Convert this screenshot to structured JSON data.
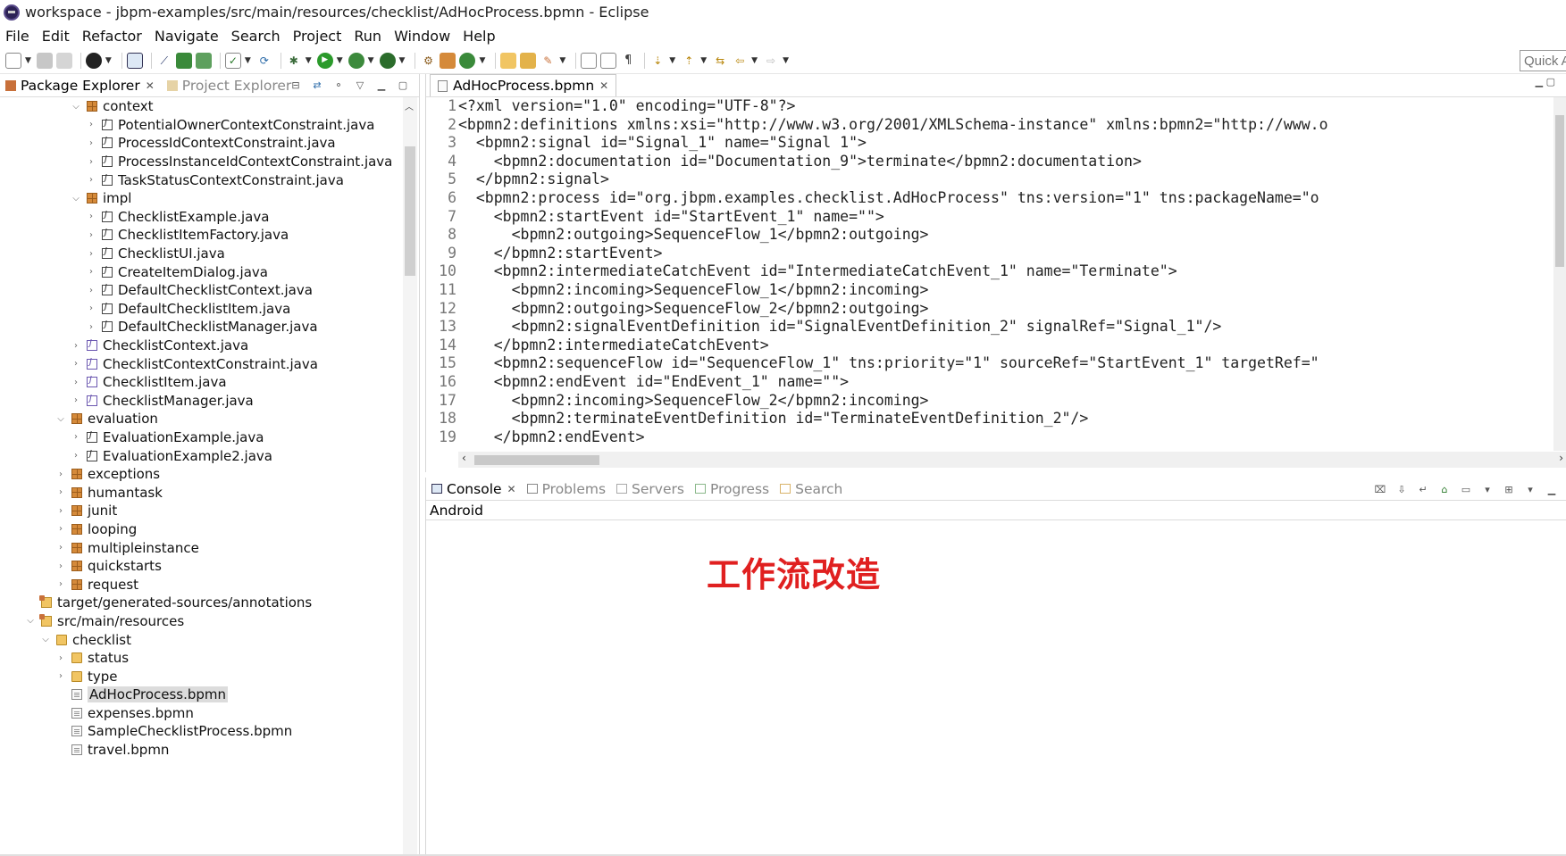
{
  "window": {
    "title": "workspace - jbpm-examples/src/main/resources/checklist/AdHocProcess.bpmn - Eclipse"
  },
  "menu": [
    "File",
    "Edit",
    "Refactor",
    "Navigate",
    "Search",
    "Project",
    "Run",
    "Window",
    "Help"
  ],
  "toolbar": {
    "quick_access_placeholder": "Quick A"
  },
  "left_panel": {
    "tabs": [
      {
        "label": "Package Explorer",
        "active": true
      },
      {
        "label": "Project Explorer",
        "active": false
      }
    ],
    "tree": [
      {
        "depth": 4,
        "twisty": "expanded",
        "icon": "package",
        "label": "context"
      },
      {
        "depth": 5,
        "twisty": "collapsed",
        "icon": "java",
        "label": "PotentialOwnerContextConstraint.java"
      },
      {
        "depth": 5,
        "twisty": "collapsed",
        "icon": "java",
        "label": "ProcessIdContextConstraint.java"
      },
      {
        "depth": 5,
        "twisty": "collapsed",
        "icon": "java",
        "label": "ProcessInstanceIdContextConstraint.java"
      },
      {
        "depth": 5,
        "twisty": "collapsed",
        "icon": "java",
        "label": "TaskStatusContextConstraint.java"
      },
      {
        "depth": 4,
        "twisty": "expanded",
        "icon": "package",
        "label": "impl"
      },
      {
        "depth": 5,
        "twisty": "collapsed",
        "icon": "java",
        "label": "ChecklistExample.java"
      },
      {
        "depth": 5,
        "twisty": "collapsed",
        "icon": "java",
        "label": "ChecklistItemFactory.java"
      },
      {
        "depth": 5,
        "twisty": "collapsed",
        "icon": "java",
        "label": "ChecklistUI.java"
      },
      {
        "depth": 5,
        "twisty": "collapsed",
        "icon": "java",
        "label": "CreateItemDialog.java"
      },
      {
        "depth": 5,
        "twisty": "collapsed",
        "icon": "java",
        "label": "DefaultChecklistContext.java"
      },
      {
        "depth": 5,
        "twisty": "collapsed",
        "icon": "java",
        "label": "DefaultChecklistItem.java"
      },
      {
        "depth": 5,
        "twisty": "collapsed",
        "icon": "java",
        "label": "DefaultChecklistManager.java"
      },
      {
        "depth": 4,
        "twisty": "collapsed",
        "icon": "interface",
        "label": "ChecklistContext.java"
      },
      {
        "depth": 4,
        "twisty": "collapsed",
        "icon": "interface",
        "label": "ChecklistContextConstraint.java"
      },
      {
        "depth": 4,
        "twisty": "collapsed",
        "icon": "interface",
        "label": "ChecklistItem.java"
      },
      {
        "depth": 4,
        "twisty": "collapsed",
        "icon": "interface",
        "label": "ChecklistManager.java"
      },
      {
        "depth": 3,
        "twisty": "expanded",
        "icon": "package",
        "label": "evaluation"
      },
      {
        "depth": 4,
        "twisty": "collapsed",
        "icon": "java",
        "label": "EvaluationExample.java"
      },
      {
        "depth": 4,
        "twisty": "collapsed",
        "icon": "java",
        "label": "EvaluationExample2.java"
      },
      {
        "depth": 3,
        "twisty": "collapsed",
        "icon": "package",
        "label": "exceptions"
      },
      {
        "depth": 3,
        "twisty": "collapsed",
        "icon": "package",
        "label": "humantask"
      },
      {
        "depth": 3,
        "twisty": "collapsed",
        "icon": "package",
        "label": "junit"
      },
      {
        "depth": 3,
        "twisty": "collapsed",
        "icon": "package",
        "label": "looping"
      },
      {
        "depth": 3,
        "twisty": "collapsed",
        "icon": "package",
        "label": "multipleinstance"
      },
      {
        "depth": 3,
        "twisty": "collapsed",
        "icon": "package",
        "label": "quickstarts"
      },
      {
        "depth": 3,
        "twisty": "collapsed",
        "icon": "package",
        "label": "request"
      },
      {
        "depth": 1,
        "twisty": "none",
        "icon": "srcfolder",
        "label": "target/generated-sources/annotations"
      },
      {
        "depth": 1,
        "twisty": "expanded",
        "icon": "srcfolder",
        "label": "src/main/resources"
      },
      {
        "depth": 2,
        "twisty": "expanded",
        "icon": "folder",
        "label": "checklist"
      },
      {
        "depth": 3,
        "twisty": "collapsed",
        "icon": "folder",
        "label": "status"
      },
      {
        "depth": 3,
        "twisty": "collapsed",
        "icon": "folder",
        "label": "type"
      },
      {
        "depth": 3,
        "twisty": "none",
        "icon": "file",
        "label": "AdHocProcess.bpmn",
        "selected": true
      },
      {
        "depth": 3,
        "twisty": "none",
        "icon": "file",
        "label": "expenses.bpmn"
      },
      {
        "depth": 3,
        "twisty": "none",
        "icon": "file",
        "label": "SampleChecklistProcess.bpmn"
      },
      {
        "depth": 3,
        "twisty": "none",
        "icon": "file",
        "label": "travel.bpmn"
      }
    ]
  },
  "editor": {
    "tab_label": "AdHocProcess.bpmn",
    "lines": [
      {
        "n": "1",
        "text": "<?xml version=\"1.0\" encoding=\"UTF-8\"?>"
      },
      {
        "n": "2",
        "text": "<bpmn2:definitions xmlns:xsi=\"http://www.w3.org/2001/XMLSchema-instance\" xmlns:bpmn2=\"http://www.o"
      },
      {
        "n": "3",
        "text": "  <bpmn2:signal id=\"Signal_1\" name=\"Signal 1\">"
      },
      {
        "n": "4",
        "text": "    <bpmn2:documentation id=\"Documentation_9\">terminate</bpmn2:documentation>"
      },
      {
        "n": "5",
        "text": "  </bpmn2:signal>"
      },
      {
        "n": "6",
        "text": "  <bpmn2:process id=\"org.jbpm.examples.checklist.AdHocProcess\" tns:version=\"1\" tns:packageName=\"o"
      },
      {
        "n": "7",
        "text": "    <bpmn2:startEvent id=\"StartEvent_1\" name=\"\">"
      },
      {
        "n": "8",
        "text": "      <bpmn2:outgoing>SequenceFlow_1</bpmn2:outgoing>"
      },
      {
        "n": "9",
        "text": "    </bpmn2:startEvent>"
      },
      {
        "n": "10",
        "text": "    <bpmn2:intermediateCatchEvent id=\"IntermediateCatchEvent_1\" name=\"Terminate\">"
      },
      {
        "n": "11",
        "text": "      <bpmn2:incoming>SequenceFlow_1</bpmn2:incoming>"
      },
      {
        "n": "12",
        "text": "      <bpmn2:outgoing>SequenceFlow_2</bpmn2:outgoing>"
      },
      {
        "n": "13",
        "text": "      <bpmn2:signalEventDefinition id=\"SignalEventDefinition_2\" signalRef=\"Signal_1\"/>"
      },
      {
        "n": "14",
        "text": "    </bpmn2:intermediateCatchEvent>"
      },
      {
        "n": "15",
        "text": "    <bpmn2:sequenceFlow id=\"SequenceFlow_1\" tns:priority=\"1\" sourceRef=\"StartEvent_1\" targetRef=\""
      },
      {
        "n": "16",
        "text": "    <bpmn2:endEvent id=\"EndEvent_1\" name=\"\">"
      },
      {
        "n": "17",
        "text": "      <bpmn2:incoming>SequenceFlow_2</bpmn2:incoming>"
      },
      {
        "n": "18",
        "text": "      <bpmn2:terminateEventDefinition id=\"TerminateEventDefinition_2\"/>"
      },
      {
        "n": "19",
        "text": "    </bpmn2:endEvent>"
      }
    ]
  },
  "console": {
    "tabs": [
      {
        "label": "Console",
        "active": true
      },
      {
        "label": "Problems",
        "active": false
      },
      {
        "label": "Servers",
        "active": false
      },
      {
        "label": "Progress",
        "active": false
      },
      {
        "label": "Search",
        "active": false
      }
    ],
    "subtitle": "Android",
    "overlay_text": "工作流改造",
    "overlay_color": "#e02020"
  }
}
